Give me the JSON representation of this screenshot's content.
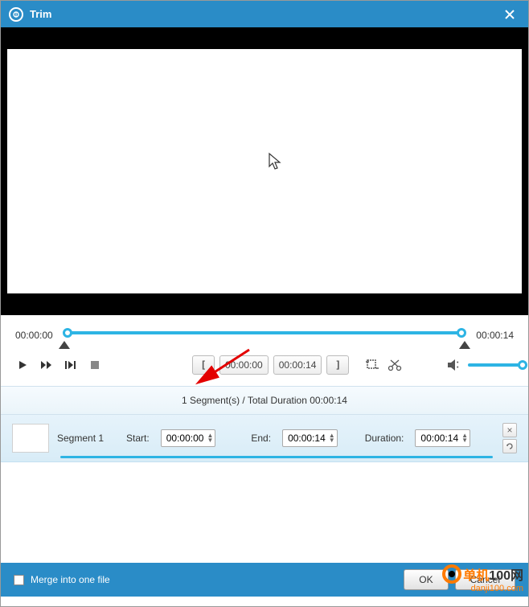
{
  "window": {
    "title": "Trim"
  },
  "timeline": {
    "start": "00:00:00",
    "end": "00:00:14"
  },
  "trim": {
    "in": "00:00:00",
    "out": "00:00:14"
  },
  "summary": "1 Segment(s) / Total Duration 00:00:14",
  "segment": {
    "name": "Segment 1",
    "start_label": "Start:",
    "start": "00:00:00",
    "end_label": "End:",
    "end": "00:00:14",
    "duration_label": "Duration:",
    "duration": "00:00:14"
  },
  "footer": {
    "merge": "Merge into one file",
    "ok": "OK",
    "cancel": "Cancel"
  },
  "watermark": {
    "brand_a": "单机",
    "brand_b": "100网",
    "url": "danji100.com"
  }
}
